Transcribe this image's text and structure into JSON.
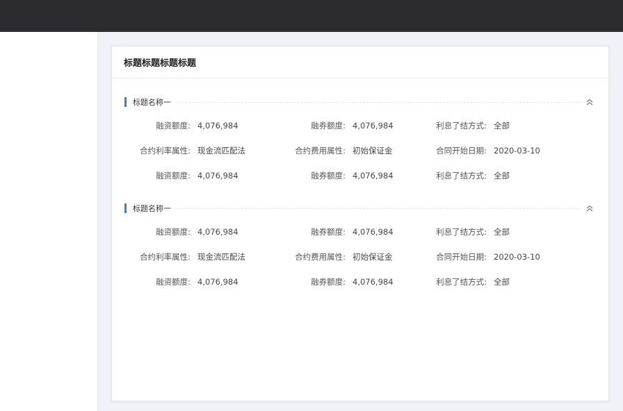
{
  "card": {
    "title": "标题标题标题标题"
  },
  "sections": [
    {
      "title": "标题名称一",
      "rows": [
        [
          {
            "label": "融资额度:",
            "value": "4,076,984"
          },
          {
            "label": "融券额度:",
            "value": "4,076,984"
          },
          {
            "label": "利息了结方式:",
            "value": "全部"
          }
        ],
        [
          {
            "label": "合约利率属性:",
            "value": "现金流匹配法"
          },
          {
            "label": "合约费用属性:",
            "value": "初始保证金"
          },
          {
            "label": "合同开始日期:",
            "value": "2020-03-10"
          }
        ],
        [
          {
            "label": "融资额度:",
            "value": "4,076,984"
          },
          {
            "label": "融券额度:",
            "value": "4,076,984"
          },
          {
            "label": "利息了结方式:",
            "value": "全部"
          }
        ]
      ]
    },
    {
      "title": "标题名称一",
      "rows": [
        [
          {
            "label": "融资额度:",
            "value": "4,076,984"
          },
          {
            "label": "融券额度:",
            "value": "4,076,984"
          },
          {
            "label": "利息了结方式:",
            "value": "全部"
          }
        ],
        [
          {
            "label": "合约利率属性:",
            "value": "现金流匹配法"
          },
          {
            "label": "合约费用属性:",
            "value": "初始保证金"
          },
          {
            "label": "合同开始日期:",
            "value": "2020-03-10"
          }
        ],
        [
          {
            "label": "融资额度:",
            "value": "4,076,984"
          },
          {
            "label": "融券额度:",
            "value": "4,076,984"
          },
          {
            "label": "利息了结方式:",
            "value": "全部"
          }
        ]
      ]
    }
  ],
  "icons": {
    "collapse": "chevron-double-up-icon"
  },
  "colors": {
    "accent": "#3a7ddd",
    "topbar": "#2c2c30",
    "background": "#f0f2f7"
  }
}
